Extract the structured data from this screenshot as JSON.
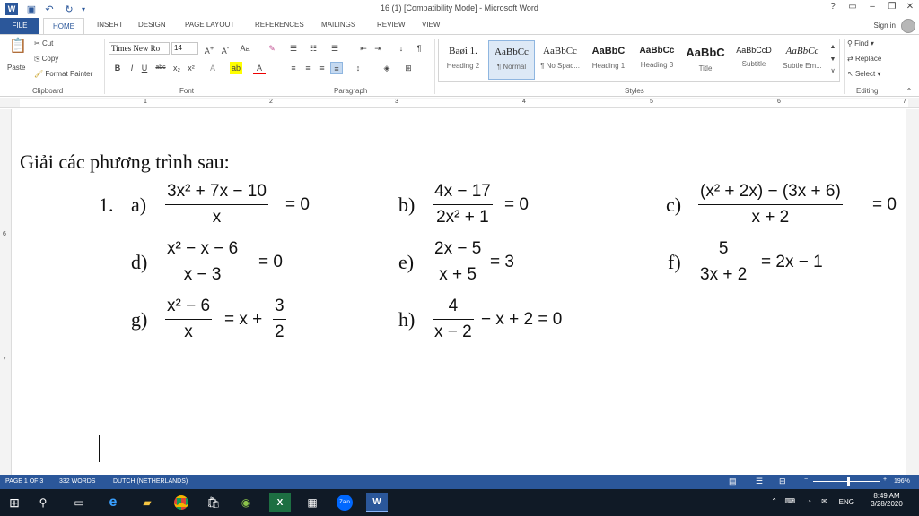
{
  "window": {
    "title": "16 (1) [Compatibility Mode] - Microsoft Word",
    "help_icon": "?",
    "quick_access": [
      "save-icon",
      "undo-icon",
      "redo-icon",
      "customize-icon"
    ]
  },
  "tabs": [
    "FILE",
    "HOME",
    "INSERT",
    "DESIGN",
    "PAGE LAYOUT",
    "REFERENCES",
    "MAILINGS",
    "REVIEW",
    "VIEW"
  ],
  "signin": "Sign in",
  "ribbon": {
    "clipboard": {
      "paste": "Paste",
      "cut": "Cut",
      "copy": "Copy",
      "format_painter": "Format Painter",
      "label": "Clipboard"
    },
    "font": {
      "name": "Times New Ro",
      "size": "14",
      "label": "Font"
    },
    "paragraph": {
      "label": "Paragraph"
    },
    "styles": {
      "label": "Styles",
      "items": [
        {
          "preview": "Baøi 1.",
          "name": "Heading 2"
        },
        {
          "preview": "AaBbCc",
          "name": "¶ Normal"
        },
        {
          "preview": "AaBbCc",
          "name": "¶ No Spac..."
        },
        {
          "preview": "AaBbC",
          "name": "Heading 1"
        },
        {
          "preview": "AaBbCc",
          "name": "Heading 3"
        },
        {
          "preview": "AaBbC",
          "name": "Title"
        },
        {
          "preview": "AaBbCcD",
          "name": "Subtitle"
        },
        {
          "preview": "AaBbCc",
          "name": "Subtle Em..."
        }
      ]
    },
    "editing": {
      "find": "Find",
      "replace": "Replace",
      "select": "Select",
      "label": "Editing"
    }
  },
  "ruler": {
    "h": [
      "1",
      "2",
      "3",
      "4",
      "5",
      "6",
      "7"
    ],
    "v": [
      "6",
      "7"
    ]
  },
  "document": {
    "heading": "Giải các phương trình sau:",
    "problem_number": "1.",
    "items": [
      {
        "label": "a)",
        "num": "3x² + 7x − 10",
        "den": "x",
        "rhs": "= 0"
      },
      {
        "label": "b)",
        "num": "4x − 17",
        "den": "2x² + 1",
        "rhs": "= 0"
      },
      {
        "label": "c)",
        "num": "(x² + 2x) − (3x + 6)",
        "den": "x + 2",
        "rhs": "= 0"
      },
      {
        "label": "d)",
        "num": "x² − x − 6",
        "den": "x − 3",
        "rhs": "= 0"
      },
      {
        "label": "e)",
        "num": "2x − 5",
        "den": "x + 5",
        "rhs": "= 3"
      },
      {
        "label": "f)",
        "num": "5",
        "den": "3x + 2",
        "rhs": "= 2x − 1"
      },
      {
        "label": "g)",
        "num": "x² − 6",
        "den": "x",
        "rhs": "= x +"
      },
      {
        "label": "h)",
        "num": "4",
        "den": "x − 2",
        "rhs": "− x + 2 = 0"
      }
    ],
    "g_extra": {
      "num": "3",
      "den": "2"
    }
  },
  "status": {
    "page": "PAGE 1 OF 3",
    "words": "332 WORDS",
    "language": "DUTCH (NETHERLANDS)",
    "zoom": "196%"
  },
  "tray": {
    "time": "8:49 AM",
    "date": "3/28/2020",
    "lang": "ENG"
  },
  "taskbar": [
    "windows-icon",
    "search-icon",
    "task-view-icon",
    "edge-icon",
    "file-explorer-icon",
    "chrome-icon",
    "store-icon",
    "app-icon",
    "excel-icon",
    "calculator-icon",
    "zalo-icon",
    "word-icon"
  ]
}
